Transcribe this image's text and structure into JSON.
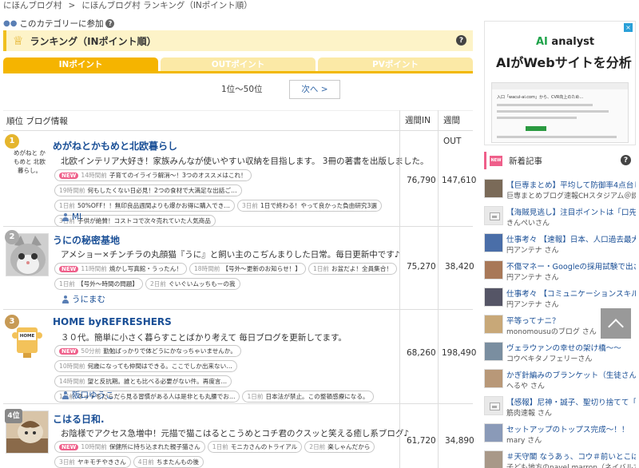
{
  "breadcrumb": {
    "home": "にほんブログ村",
    "sep": ">",
    "current": "にほんブログ村 ランキング（INポイント順）"
  },
  "category": {
    "label": "このカテゴリーに参加",
    "help": "?"
  },
  "ranking_title": {
    "label": "ランキング（INポイント順）",
    "help": "?"
  },
  "tabs": [
    {
      "label": "INポイント",
      "active": true
    },
    {
      "label": "OUTポイント",
      "active": false
    },
    {
      "label": "PVポイント",
      "active": false
    }
  ],
  "pager": {
    "range": "1位〜50位",
    "next": "次へ >"
  },
  "table": {
    "head_rank": "順位 ブログ情報",
    "head_in": "週間IN",
    "head_out": "週間OUT"
  },
  "rows": [
    {
      "rank": "1",
      "title": "めがねとかもめと北欧暮らし",
      "thumb_text": "めがねと かもめと 北欧暮らし。",
      "desc": "北欧インテリア大好き！家族みんなが使いやすい収納を目指します。 3冊の著書を出版しました。",
      "tags": [
        {
          "new": "NEW",
          "ago": "14時間前",
          "text": "子育てのイライラ解消〜！3つのオススメはこれ！"
        },
        {
          "ago": "19時間前",
          "text": "何もしたくない日必見！2つの食材で大満足な出話ご…"
        },
        {
          "ago": "1日前",
          "text": "50%OFF！！無印良品週間よりも爆かお得に購入でき…"
        },
        {
          "ago": "3日前",
          "text": "1日で終わる！やって良かった負由研究3選"
        },
        {
          "ago": "3日前",
          "text": "子供が絶賛！コストコで次々売れていた人気商品"
        }
      ],
      "author": "MI",
      "in": "76,790",
      "out": "147,610"
    },
    {
      "rank": "2",
      "title": "うにの秘密基地",
      "desc": "アメショー×チンチラの丸顔猫『うに』と飼い主のこぢんまりした日常。毎日更新中です♪",
      "tags": [
        {
          "new": "NEW",
          "ago": "11時間前",
          "text": "焼かし写真館・うったん！"
        },
        {
          "ago": "18時間前",
          "text": "【号外〜更新のお知らせ！】"
        },
        {
          "ago": "1日前",
          "text": "お盆だよ！全員集合！"
        },
        {
          "ago": "1日前",
          "text": "【号外〜時間の問題】"
        },
        {
          "ago": "2日前",
          "text": "ぐいぐいムッちもーの我"
        }
      ],
      "author": "うにまむ",
      "in": "75,270",
      "out": "38,420"
    },
    {
      "rank": "3",
      "title": "HOME byREFRESHERS",
      "thumb_text": "HOME",
      "desc": "３０代。簡単に小さく暮らすことばかり考えて 毎日ブログを更新してます。",
      "tags": [
        {
          "new": "NEW",
          "ago": "50分前",
          "text": "勤勉ばっかりで体どうにかなっちゃいませんか。"
        },
        {
          "ago": "10時間前",
          "text": "何歳になっても仲間はできる。ここでしか出来ない…"
        },
        {
          "ago": "14時間前",
          "text": "望と反抗期。誰とも比べる必要がない件。再度言…"
        },
        {
          "ago": "1日前",
          "text": "ネットをだらだら見る習慣がある人は是非とも丸腰でお…"
        },
        {
          "ago": "1日前",
          "text": "日本法が禁止。この整頓感療になる。"
        }
      ],
      "author": "阪口ゆうこ",
      "in": "68,260",
      "out": "198,490"
    },
    {
      "rank": "4位",
      "title": "こはる日和.",
      "desc": "お陰様でアクセス急増中！元描で猫こはるとこうめとコチ君のクスッと笑える癒し系ブログ♪",
      "tags": [
        {
          "new": "NEW",
          "ago": "10時間前",
          "text": "保健所に持ち込まれた親子猫さん"
        },
        {
          "ago": "1日前",
          "text": "モニカさんのトライアル"
        },
        {
          "ago": "2日前",
          "text": "楽しゃんだから"
        },
        {
          "ago": "3日前",
          "text": "ヤキモチやきさん"
        },
        {
          "ago": "4日前",
          "text": "ちまたんもの後"
        }
      ],
      "author": "",
      "in": "61,720",
      "out": "34,890"
    }
  ],
  "ad": {
    "logo_ai": "AI",
    "logo_rest": " analyst",
    "headline": "AIがWebサイトを分析",
    "mock_text": "入口「wacul-ai.com」から、CVR向上のため…",
    "close": "×"
  },
  "news": {
    "new_label": "NEW",
    "title": "新着記事",
    "help": "?",
    "items": [
      {
        "title": "【巨専まとめ】平均して防御率4点台じゃな…",
        "source": "巨専まとめブログ速報CHスタジアム＠読売ジャイアンツ（巨人）さん",
        "img": true
      },
      {
        "title": "【海賊見逃し】注目ポイントは「口先介入…",
        "source": "きんぺいさん",
        "img": false
      },
      {
        "title": "仕事考々 【速報】日本、人口過去最大43…",
        "source": "円アンテナ さん",
        "img": true
      },
      {
        "title": "不傷マネー・Googleの採用試験で出さ…",
        "source": "円アンテナ さん",
        "img": true
      },
      {
        "title": "仕事考々 【コミュニケーションスキル】…",
        "source": "円アンテナ さん",
        "img": true
      },
      {
        "title": "平等ってナニ？",
        "source": "monomousuのブログ さん",
        "img": true
      },
      {
        "title": "ヴェラウァンの幸せの架け橋〜〜",
        "source": "コウベキタノフェリーさん",
        "img": true
      },
      {
        "title": "かぎ針編みのブランケット（生徒さんの作…",
        "source": "へるや さん",
        "img": true
      },
      {
        "title": "【感報】尼神・誠子、聖切り捨てて「可愛…",
        "source": "筋肉速報 さん",
        "img": false
      },
      {
        "title": "セットアップのトップス完成〜！！",
        "source": "mary さん",
        "img": true
      },
      {
        "title": "＃天守閣 なうあぅ、コウ＃前いとこは吾…",
        "source": "子ども地方のnavel marron（ネイバルマ…",
        "img": true
      }
    ]
  },
  "colors": {
    "accent": "#f5b400",
    "link": "#1a4f96",
    "new": "#ef5f8a"
  }
}
